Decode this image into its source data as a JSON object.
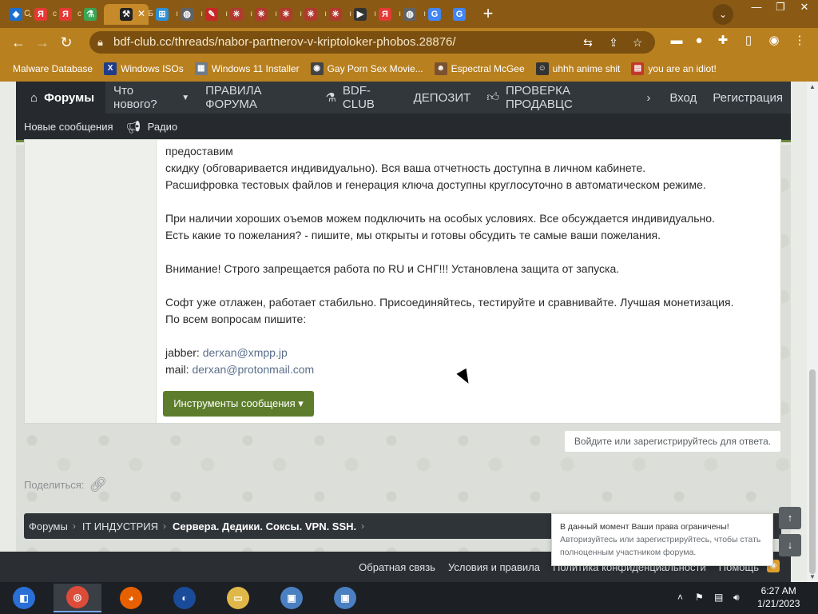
{
  "browser": {
    "tabs": [
      {
        "icon": "cube-favicon-icon",
        "glyph": "◆",
        "color": "#1a6fd1",
        "char": "Ꮹ"
      },
      {
        "icon": "yandex-favicon-icon",
        "glyph": "Я",
        "color": "#e53935",
        "char": "с"
      },
      {
        "icon": "yandex-favicon-icon",
        "glyph": "Я",
        "color": "#e53935",
        "char": "с"
      },
      {
        "icon": "flask-favicon-icon",
        "glyph": "⚗",
        "color": "#3aa655",
        "char": "ı"
      },
      {
        "icon": "xda-favicon-icon",
        "glyph": "⚒",
        "color": "#222222",
        "char": "Б",
        "active": true
      },
      {
        "icon": "grid-favicon-icon",
        "glyph": "⊞",
        "color": "#2d8fd5",
        "char": "ı"
      },
      {
        "icon": "globe-favicon-icon",
        "glyph": "◍",
        "color": "#5f6368",
        "char": "ı"
      },
      {
        "icon": "feather-favicon-icon",
        "glyph": "✎",
        "color": "#c62828",
        "char": "ı"
      },
      {
        "icon": "spider-favicon-icon",
        "glyph": "✳",
        "color": "#b03a2e",
        "char": "ı"
      },
      {
        "icon": "spider-favicon-icon",
        "glyph": "✳",
        "color": "#b03a2e",
        "char": "ı"
      },
      {
        "icon": "spider-favicon-icon",
        "glyph": "✳",
        "color": "#b03a2e",
        "char": "ı"
      },
      {
        "icon": "spider-favicon-icon",
        "glyph": "✳",
        "color": "#b03a2e",
        "char": "ı"
      },
      {
        "icon": "spider-favicon-icon",
        "glyph": "✳",
        "color": "#b03a2e",
        "char": "ı"
      },
      {
        "icon": "terminal-favicon-icon",
        "glyph": "▶",
        "color": "#333333",
        "char": "ı"
      },
      {
        "icon": "yandex-favicon-icon",
        "glyph": "Я",
        "color": "#e53935",
        "char": "ı"
      },
      {
        "icon": "globe-favicon-icon",
        "glyph": "◍",
        "color": "#5f6368",
        "char": "ı"
      },
      {
        "icon": "google-favicon-icon",
        "glyph": "G",
        "color": "#4285f4",
        "char": ""
      },
      {
        "icon": "google-favicon-icon",
        "glyph": "G",
        "color": "#4285f4",
        "char": ""
      }
    ],
    "url": "bdf-club.cc/threads/nabor-partnerov-v-kriptoloker-phobos.28876/",
    "bookmarks": [
      {
        "label": "Malware Database",
        "glyph": "",
        "color": "#b9801f"
      },
      {
        "label": "Windows ISOs",
        "glyph": "X",
        "color": "#1f3c88"
      },
      {
        "label": "Windows 11 Installer",
        "glyph": "▦",
        "color": "#6e7b8b"
      },
      {
        "label": "Gay Porn Sex Movie...",
        "glyph": "◉",
        "color": "#444444"
      },
      {
        "label": "Espectral McGee",
        "glyph": "☻",
        "color": "#7a5230"
      },
      {
        "label": "uhhh anime shit",
        "glyph": "☺",
        "color": "#333333"
      },
      {
        "label": "you are an idiot!",
        "glyph": "▤",
        "color": "#c0392b"
      }
    ]
  },
  "site": {
    "nav": {
      "home": "Форумы",
      "whats_new": "Что нового?",
      "rules": "ПРАВИЛА ФОРУМА",
      "club": "BDF-CLUB",
      "deposit": "ДЕПОЗИТ",
      "check": "ПРОВЕРКА ПРОДАВЦС",
      "login": "Вход",
      "register": "Регистрация"
    },
    "subnav": {
      "new_posts": "Новые сообщения",
      "radio": "Радио"
    },
    "post": {
      "lines": [
        "предоставим",
        "скидку (обговаривается индивидуально). Вся ваша отчетность доступна в личном кабинете.",
        "Расшифровка тестовых файлов и генерация ключа доступны круглосуточно в автоматическом режиме."
      ],
      "para2": [
        "При наличии хороших оъемов можем подключить на особых условиях. Все обсуждается индивидуально.",
        "Есть какие то пожелания? - пишите, мы открыты и готовы обсудить те самые ваши пожелания."
      ],
      "para3": "Внимание! Строго запрещается работа по RU и СНГ!!! Установлена защита от запуска.",
      "para4": [
        "Софт уже отлажен, работает стабильно. Присоединяйтесь, тестируйте и сравнивайте. Лучшая монетизация.",
        "По всем вопросам пишите:"
      ],
      "jabber_label": "jabber:",
      "jabber": "derxan@xmpp.jp",
      "mail_label": "mail:",
      "mail": "derxan@protonmail.com",
      "tools_button": "Инструменты сообщения ▾"
    },
    "reply_note": "Войдите или зарегистрируйтесь для ответа.",
    "share": "Поделиться:",
    "breadcrumb": [
      "Форумы",
      "IT ИНДУСТРИЯ",
      "Сервера. Дедики. Соксы. VPN. SSH."
    ],
    "footer": [
      "Обратная связь",
      "Условия и правила",
      "Политика конфиденциальности",
      "Помощь"
    ],
    "toast": {
      "line1": "В данный момент Ваши права ограничены!",
      "line2": "Авторизуйтесь или зарегистрируйтесь, чтобы стать",
      "line3": "полноценным участником форума."
    }
  },
  "taskbar": {
    "apps": [
      {
        "name": "windows-app-icon",
        "color": "#2a6fd6",
        "glyph": "◧"
      },
      {
        "name": "chrome-app-icon",
        "color": "#dd4b39",
        "glyph": "◎",
        "active": true
      },
      {
        "name": "firefox-app-icon",
        "color": "#e66000",
        "glyph": "◕"
      },
      {
        "name": "obama-logo-app-icon",
        "color": "#1a4b9b",
        "glyph": "◐"
      },
      {
        "name": "file-explorer-app-icon",
        "color": "#e0b84a",
        "glyph": "▭"
      },
      {
        "name": "network-setup-app-icon",
        "color": "#4a7fc1",
        "glyph": "▣"
      },
      {
        "name": "network-setup-app-icon-2",
        "color": "#4a7fc1",
        "glyph": "▣"
      }
    ],
    "time": "6:27 AM",
    "date": "1/21/2023"
  }
}
